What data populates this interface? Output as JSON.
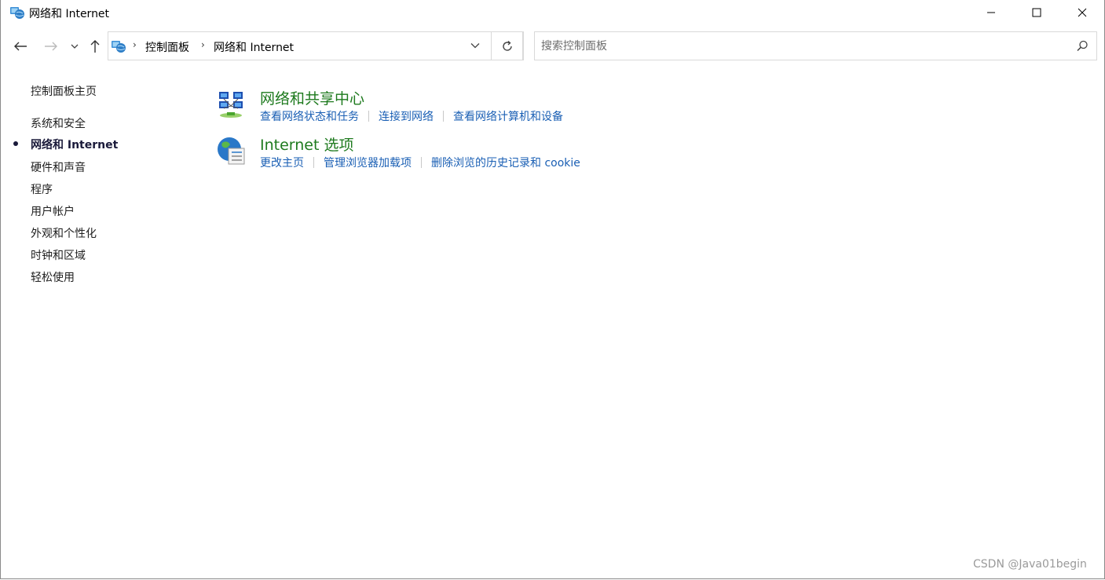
{
  "window": {
    "title": "网络和 Internet",
    "icon": "network-globe-icon"
  },
  "address_bar": {
    "breadcrumbs": [
      "控制面板",
      "网络和 Internet"
    ]
  },
  "search": {
    "placeholder": "搜索控制面板"
  },
  "sidebar": {
    "items": [
      {
        "label": "控制面板主页",
        "active": false
      },
      {
        "label": "系统和安全",
        "active": false
      },
      {
        "label": "网络和 Internet",
        "active": true
      },
      {
        "label": "硬件和声音",
        "active": false
      },
      {
        "label": "程序",
        "active": false
      },
      {
        "label": "用户帐户",
        "active": false
      },
      {
        "label": "外观和个性化",
        "active": false
      },
      {
        "label": "时钟和区域",
        "active": false
      },
      {
        "label": "轻松使用",
        "active": false
      }
    ]
  },
  "sections": [
    {
      "title": "网络和共享中心",
      "icon": "network-sharing-center-icon",
      "links": [
        "查看网络状态和任务",
        "连接到网络",
        "查看网络计算机和设备"
      ]
    },
    {
      "title": "Internet 选项",
      "icon": "internet-options-icon",
      "links": [
        "更改主页",
        "管理浏览器加载项",
        "删除浏览的历史记录和 cookie"
      ]
    }
  ],
  "watermark": "CSDN @Java01begin",
  "colors": {
    "section_title": "#1e7a1e",
    "link": "#1a5fb4",
    "border": "#d9d9d9"
  }
}
